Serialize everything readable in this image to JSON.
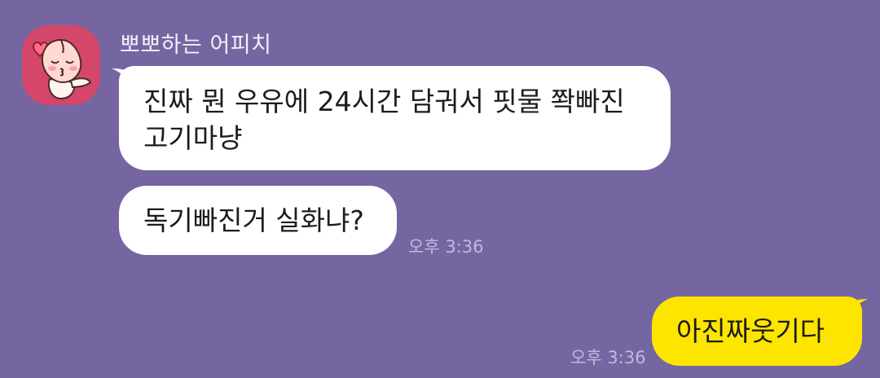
{
  "conversation": {
    "sender": {
      "name": "뽀뽀하는 어피치",
      "avatar_icon": "apeach-kiss-avatar-icon"
    },
    "incoming": [
      {
        "lines": [
          "진짜 뭔 우유에 24시간 담궈서 핏물 쫙빠진",
          "고기마냥"
        ]
      },
      {
        "lines": [
          "독기빠진거 실화냐?"
        ],
        "time": "오후 3:36"
      }
    ],
    "outgoing": [
      {
        "text": "아진짜웃기다",
        "time": "오후 3:36"
      }
    ]
  },
  "colors": {
    "background": "#7566a1",
    "incoming_bubble": "#ffffff",
    "outgoing_bubble": "#fee500",
    "avatar_bg": "#d5476a"
  }
}
